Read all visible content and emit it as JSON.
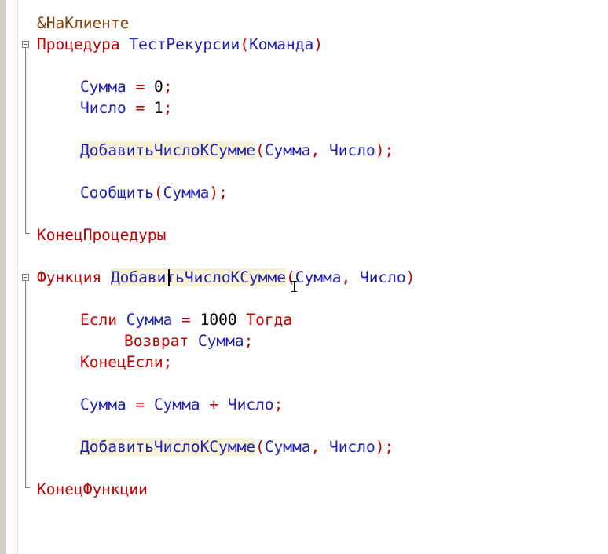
{
  "editor": {
    "directive": "&НаКлиенте",
    "proc": {
      "kw": "Процедура",
      "name": "ТестРекурсии",
      "open": "(",
      "param": "Команда",
      "close": ")"
    },
    "line_summa0": {
      "var": "Сумма",
      "op": " = ",
      "val": "0",
      "semi": ";"
    },
    "line_chislo1": {
      "var": "Число",
      "op": " = ",
      "val": "1",
      "semi": ";"
    },
    "call1": {
      "name": "ДобавитьЧислоКСумме",
      "open": "(",
      "arg1": "Сумма",
      "comma": ", ",
      "arg2": "Число",
      "close": ");"
    },
    "msg": {
      "name": "Сообщить",
      "open": "(",
      "arg": "Сумма",
      "close": ");"
    },
    "end_proc": "КонецПроцедуры",
    "func": {
      "kw": "Функция",
      "name_a": "Добав",
      "name_b": "итьЧислоКСумме",
      "open": "(",
      "arg1": "Сумма",
      "comma": ", ",
      "arg2": "Число",
      "close": ")"
    },
    "if_line": {
      "kw": "Если",
      "var": "Сумма",
      "op": " = ",
      "val": "1000",
      "then": "Тогда"
    },
    "return_line": {
      "kw": "Возврат",
      "var": "Сумма",
      "semi": ";"
    },
    "endif": "КонецЕсли;",
    "assign": {
      "var": "Сумма",
      "op": " = ",
      "var2": "Сумма",
      "plus": " + ",
      "var3": "Число",
      "semi": ";"
    },
    "call2": {
      "name": "ДобавитьЧислоКСумме",
      "open": "(",
      "arg1": "Сумма",
      "comma": ", ",
      "arg2": "Число",
      "close": ");"
    },
    "end_func": "КонецФункции"
  },
  "colors": {
    "keyword": "#c00000",
    "identifier": "#1f1fb0",
    "number": "#000000",
    "directive": "#8b3a00",
    "highlight": "#f7f1d6"
  }
}
